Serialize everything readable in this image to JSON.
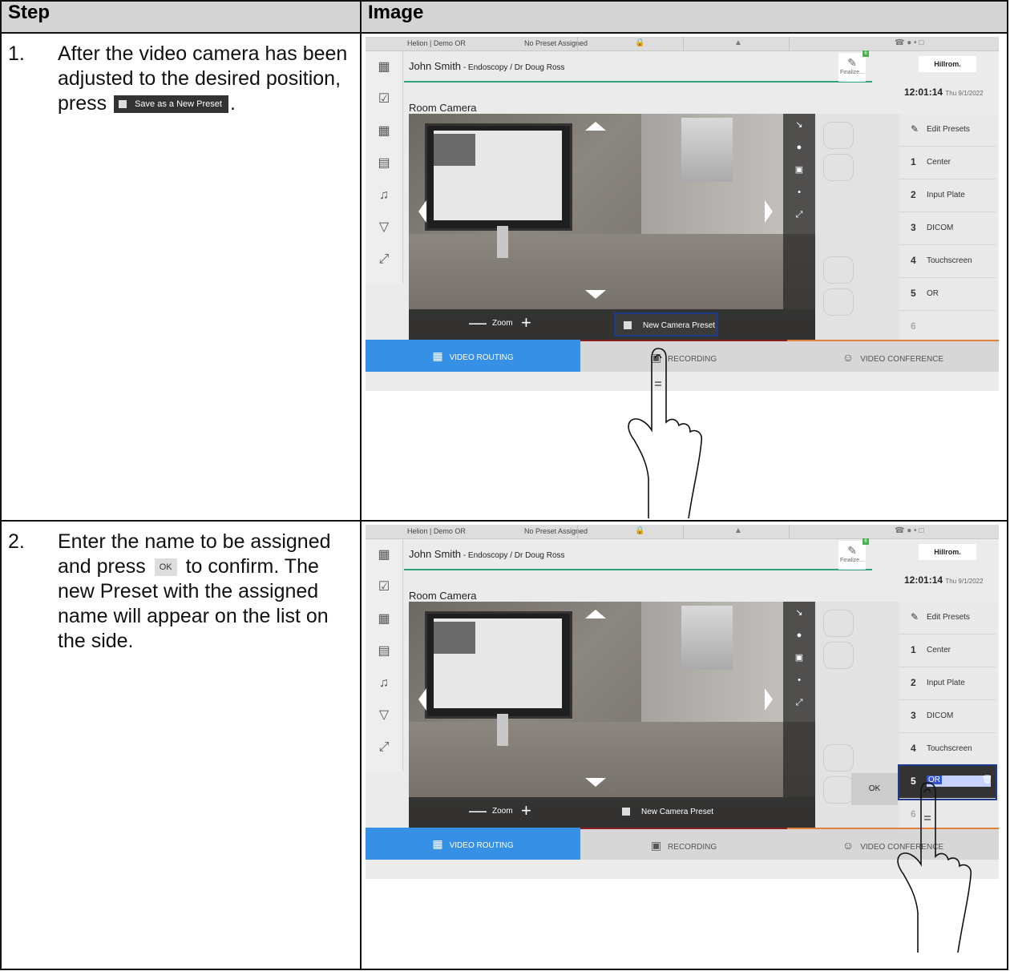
{
  "table": {
    "col_step": "Step",
    "col_image": "Image"
  },
  "steps": [
    {
      "number": "1.",
      "text_a": "After the video camera has been adjusted to the desired position, press",
      "button": "Save as a New Preset",
      "text_b": "."
    },
    {
      "number": "2.",
      "text_a": "Enter the name to be assigned and press",
      "button": "OK",
      "text_b": "to confirm. The new Preset with the assigned name will appear on the list on the side."
    }
  ],
  "ui": {
    "location": "Helion | Demo OR",
    "preset_status": "No Preset Assigned",
    "patient": "John Smith",
    "procedure": " - Endoscopy / Dr Doug Ross",
    "finalize": "Finalize...",
    "logo": "Hillrom.",
    "time": "12:01:14",
    "date": "Thu 9/1/2022",
    "panel_title": "Room Camera",
    "zoom_label": "Zoom",
    "new_preset_label": "New Camera Preset",
    "edit_presets": "Edit Presets",
    "presets": [
      {
        "num": "1",
        "label": "Center"
      },
      {
        "num": "2",
        "label": "Input Plate"
      },
      {
        "num": "3",
        "label": "DICOM"
      },
      {
        "num": "4",
        "label": "Touchscreen"
      },
      {
        "num": "5",
        "label": "OR"
      },
      {
        "num": "6",
        "label": ""
      }
    ],
    "ok_label": "OK",
    "edit_value": "OR",
    "tabs": [
      "VIDEO ROUTING",
      "RECORDING",
      "VIDEO CONFERENCE"
    ]
  }
}
